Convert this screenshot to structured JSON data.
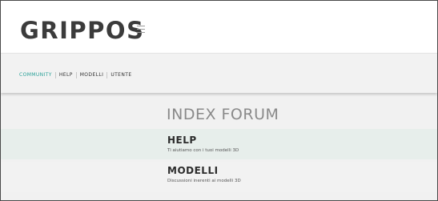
{
  "header": {
    "logo_text": "GRIPPOS"
  },
  "nav": {
    "items": [
      {
        "label": "COMMUNITY",
        "active": true
      },
      {
        "label": "HELP",
        "active": false
      },
      {
        "label": "MODELLI",
        "active": false
      },
      {
        "label": "UTENTE",
        "active": false
      }
    ]
  },
  "main": {
    "title": "INDEX FORUM",
    "forums": [
      {
        "title": "HELP",
        "description": "Ti aiutiamo con i tuoi modelli 3D"
      },
      {
        "title": "MODELLI",
        "description": "Discussioni inerenti ai modelli 3D"
      }
    ]
  },
  "colors": {
    "accent": "#2aa198",
    "highlight_row": "#e7eeeb"
  }
}
